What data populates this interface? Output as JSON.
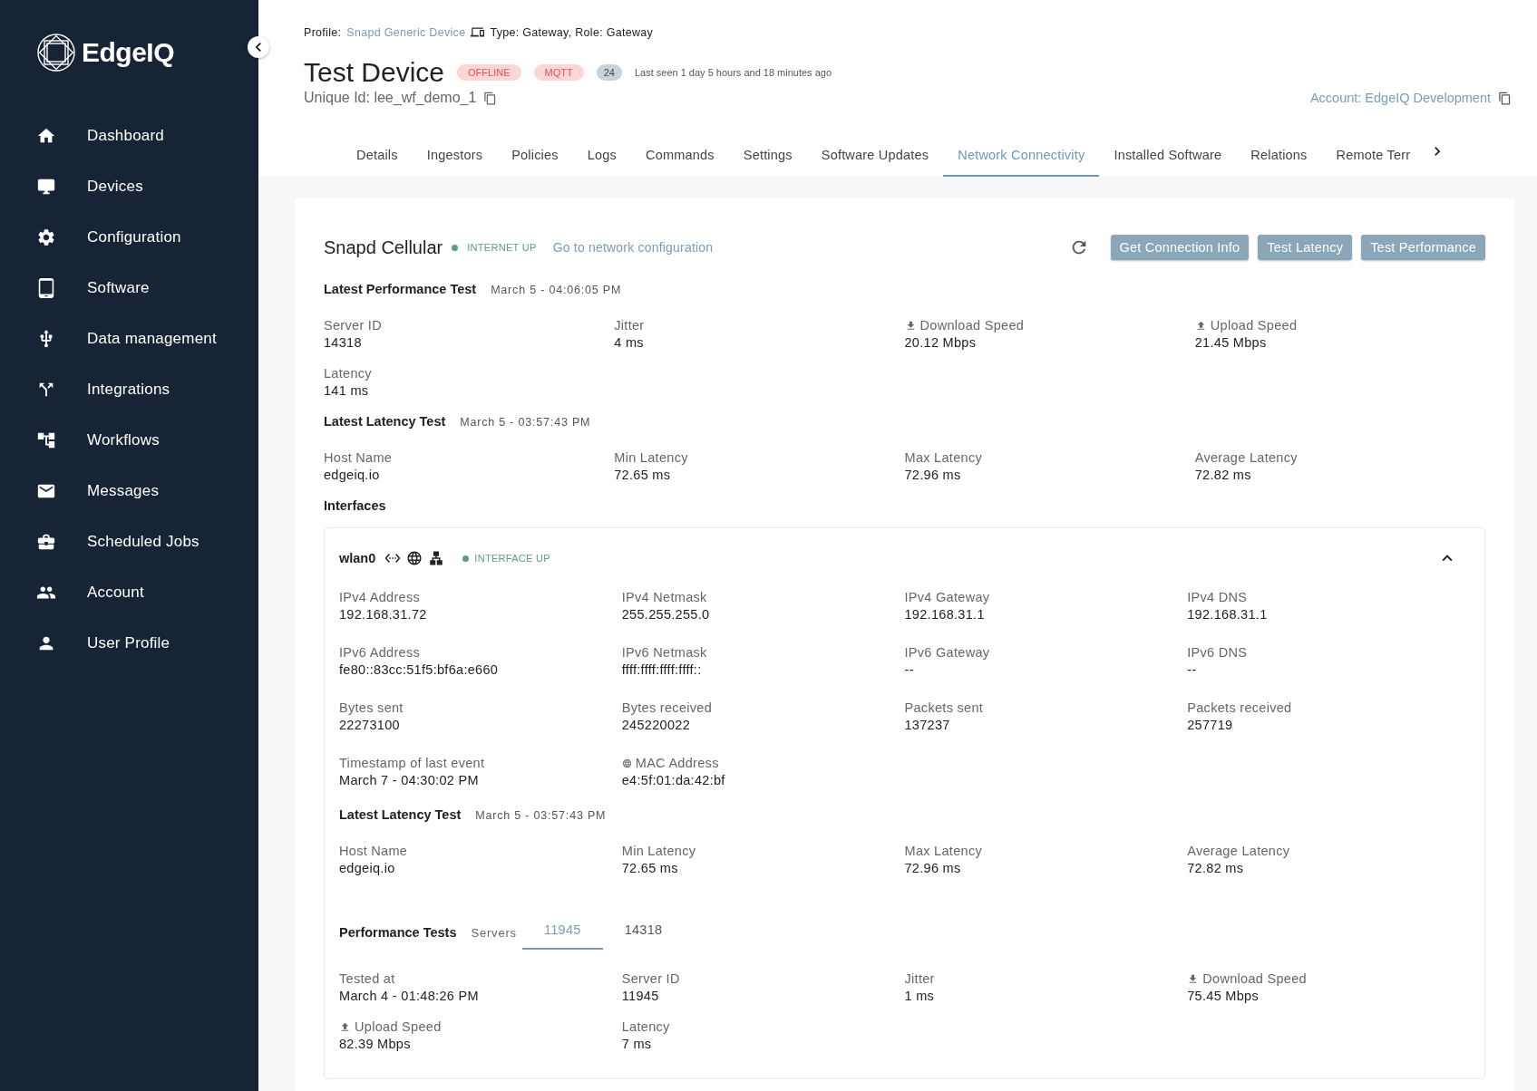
{
  "sidebar": {
    "logo": "EdgeIQ",
    "items": [
      {
        "label": "Dashboard"
      },
      {
        "label": "Devices"
      },
      {
        "label": "Configuration"
      },
      {
        "label": "Software"
      },
      {
        "label": "Data management"
      },
      {
        "label": "Integrations"
      },
      {
        "label": "Workflows"
      },
      {
        "label": "Messages"
      },
      {
        "label": "Scheduled Jobs"
      },
      {
        "label": "Account"
      },
      {
        "label": "User Profile"
      }
    ]
  },
  "header": {
    "profile_label": "Profile:",
    "profile_link": "Snapd Generic Device",
    "type_text": "Type: Gateway, Role: Gateway",
    "title": "Test Device",
    "badges": [
      {
        "text": "OFFLINE",
        "kind": "alert"
      },
      {
        "text": "MQTT",
        "kind": "alert"
      },
      {
        "text": "24",
        "kind": "count"
      }
    ],
    "last_seen": "Last seen 1 day 5 hours and 18 minutes ago",
    "unique_id": "Unique Id: lee_wf_demo_1",
    "account": "Account: EdgeIQ Development"
  },
  "tabs": [
    {
      "label": "Details",
      "selected": false
    },
    {
      "label": "Ingestors",
      "selected": false
    },
    {
      "label": "Policies",
      "selected": false
    },
    {
      "label": "Logs",
      "selected": false
    },
    {
      "label": "Commands",
      "selected": false
    },
    {
      "label": "Settings",
      "selected": false
    },
    {
      "label": "Software Updates",
      "selected": false
    },
    {
      "label": "Network Connectivity",
      "selected": true
    },
    {
      "label": "Installed Software",
      "selected": false
    },
    {
      "label": "Relations",
      "selected": false
    },
    {
      "label": "Remote Terr",
      "selected": false
    }
  ],
  "card": {
    "title": "Snapd Cellular",
    "status": {
      "text": "INTERNET UP",
      "up": true
    },
    "link": "Go to network configuration",
    "buttons": [
      "Get Connection Info",
      "Test Latency",
      "Test Performance"
    ],
    "sections": [
      {
        "title": "Latest Performance Test",
        "date": "March 5 - 04:06:05 PM",
        "fields": [
          {
            "label": "Server ID",
            "value": "14318"
          },
          {
            "label": "Jitter",
            "value": "4 ms"
          },
          {
            "label": "Download Speed",
            "value": "20.12 Mbps",
            "kind": "download"
          },
          {
            "label": "Upload Speed",
            "value": "21.45 Mbps",
            "kind": "upload"
          },
          {
            "label": "Latency",
            "value": "141 ms"
          }
        ]
      },
      {
        "title": "Latest Latency Test",
        "date": "March 5 - 03:57:43 PM",
        "fields": [
          {
            "label": "Host Name",
            "value": "edgeiq.io"
          },
          {
            "label": "Min Latency",
            "value": "72.65 ms"
          },
          {
            "label": "Max Latency",
            "value": "72.96 ms"
          },
          {
            "label": "Average Latency",
            "value": "72.82 ms"
          }
        ]
      }
    ],
    "interfaces_title": "Interfaces",
    "interface": {
      "name": "wlan0",
      "status": {
        "text": "INTERFACE UP",
        "up": true
      },
      "expanded": true,
      "fields": [
        {
          "label": "IPv4 Address",
          "value": "192.168.31.72"
        },
        {
          "label": "IPv4 Netmask",
          "value": "255.255.255.0"
        },
        {
          "label": "IPv4 Gateway",
          "value": "192.168.31.1"
        },
        {
          "label": "IPv4 DNS",
          "value": "192.168.31.1"
        },
        {
          "label": "IPv6 Address",
          "value": "fe80::83cc:51f5:bf6a:e660"
        },
        {
          "label": "IPv6 Netmask",
          "value": "ffff:ffff:ffff:ffff::"
        },
        {
          "label": "IPv6 Gateway",
          "value": "--"
        },
        {
          "label": "IPv6 DNS",
          "value": "--"
        },
        {
          "label": "Bytes sent",
          "value": "22273100"
        },
        {
          "label": "Bytes received",
          "value": "245220022"
        },
        {
          "label": "Packets sent",
          "value": "137237"
        },
        {
          "label": "Packets received",
          "value": "257719"
        },
        {
          "label": "Timestamp of last event",
          "value": "March 7 - 04:30:02 PM"
        },
        {
          "label": "MAC Address",
          "value": "e4:5f:01:da:42:bf",
          "kind": "mac"
        }
      ],
      "latency": {
        "title": "Latest Latency Test",
        "date": "March 5 - 03:57:43 PM",
        "fields": [
          {
            "label": "Host Name",
            "value": "edgeiq.io"
          },
          {
            "label": "Min Latency",
            "value": "72.65 ms"
          },
          {
            "label": "Max Latency",
            "value": "72.96 ms"
          },
          {
            "label": "Average Latency",
            "value": "72.82 ms"
          }
        ]
      },
      "performance": {
        "title": "Performance Tests",
        "servers_label": "Servers",
        "servers": [
          {
            "label": "11945",
            "selected": true
          },
          {
            "label": "14318",
            "selected": false
          }
        ],
        "fields": [
          {
            "label": "Tested at",
            "value": "March 4 - 01:48:26 PM"
          },
          {
            "label": "Server ID",
            "value": "11945"
          },
          {
            "label": "Jitter",
            "value": "1 ms"
          },
          {
            "label": "Download Speed",
            "value": "75.45 Mbps",
            "kind": "download"
          },
          {
            "label": "Upload Speed",
            "value": "82.39 Mbps",
            "kind": "upload"
          },
          {
            "label": "Latency",
            "value": "7 ms"
          }
        ]
      }
    }
  }
}
